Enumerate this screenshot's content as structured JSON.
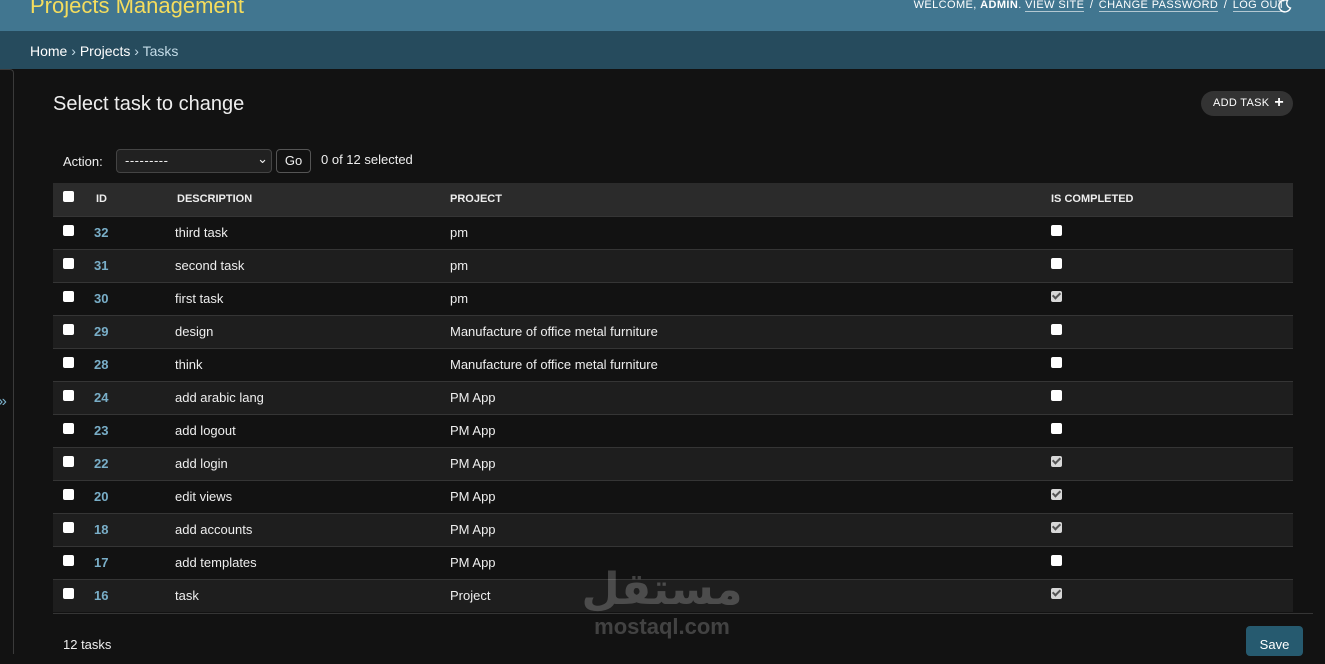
{
  "header": {
    "site_title": "Projects Management",
    "welcome": "WELCOME,",
    "username": "ADMIN",
    "view_site": "VIEW SITE",
    "change_password": "CHANGE PASSWORD",
    "log_out": "LOG OUT",
    "separator": "/",
    "theme_icon": "moon-icon"
  },
  "breadcrumbs": {
    "home": "Home",
    "projects": "Projects",
    "current": "Tasks",
    "separator": "›"
  },
  "sidebar": {
    "toggle_label": "»"
  },
  "main": {
    "title": "Select task to change",
    "add_button": "ADD TASK",
    "add_icon": "+",
    "action_label": "Action:",
    "action_value": "---------",
    "action_chevron": "⌄",
    "go_button": "Go",
    "selected_count": "0 of 12 selected",
    "columns": [
      "ID",
      "DESCRIPTION",
      "PROJECT",
      "IS COMPLETED"
    ],
    "rows": [
      {
        "id": "32",
        "description": "third task",
        "project": "pm",
        "completed": false
      },
      {
        "id": "31",
        "description": "second task",
        "project": "pm",
        "completed": false
      },
      {
        "id": "30",
        "description": "first task",
        "project": "pm",
        "completed": true
      },
      {
        "id": "29",
        "description": "design",
        "project": "Manufacture of office metal furniture",
        "completed": false
      },
      {
        "id": "28",
        "description": "think",
        "project": "Manufacture of office metal furniture",
        "completed": false
      },
      {
        "id": "24",
        "description": "add arabic lang",
        "project": "PM App",
        "completed": false
      },
      {
        "id": "23",
        "description": "add logout",
        "project": "PM App",
        "completed": false
      },
      {
        "id": "22",
        "description": "add login",
        "project": "PM App",
        "completed": true
      },
      {
        "id": "20",
        "description": "edit views",
        "project": "PM App",
        "completed": true
      },
      {
        "id": "18",
        "description": "add accounts",
        "project": "PM App",
        "completed": true
      },
      {
        "id": "17",
        "description": "add templates",
        "project": "PM App",
        "completed": false
      },
      {
        "id": "16",
        "description": "task",
        "project": "Project",
        "completed": true
      }
    ],
    "results_count": "12 tasks",
    "save_button": "Save"
  },
  "watermark": {
    "arabic": "مستقل",
    "latin": "mostaql.com"
  },
  "colors": {
    "header": "#417690",
    "breadcrumbs": "#264b5d",
    "title": "#f5dd5d",
    "link": "#79aec8",
    "background": "#121212"
  }
}
